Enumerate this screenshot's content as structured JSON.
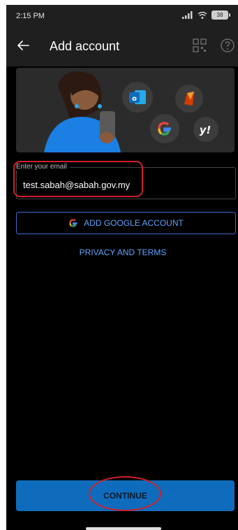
{
  "status_bar": {
    "time": "2:15 PM",
    "battery": "38"
  },
  "app_bar": {
    "title": "Add account",
    "icons": [
      "back-arrow-icon",
      "qr-code-icon",
      "help-icon"
    ]
  },
  "hero": {
    "icons": [
      "outlook-icon",
      "office-icon",
      "google-icon",
      "yahoo-icon"
    ]
  },
  "email": {
    "label": "Enter your email",
    "value": "test.sabah@sabah.gov.my"
  },
  "google_button": {
    "label": "ADD GOOGLE ACCOUNT"
  },
  "privacy_link": {
    "label": "PRIVACY AND TERMS"
  },
  "continue_button": {
    "label": "CONTINUE"
  },
  "colors": {
    "accent": "#0f6cbd",
    "link": "#5ea3ff",
    "annotation": "#d0202a"
  }
}
